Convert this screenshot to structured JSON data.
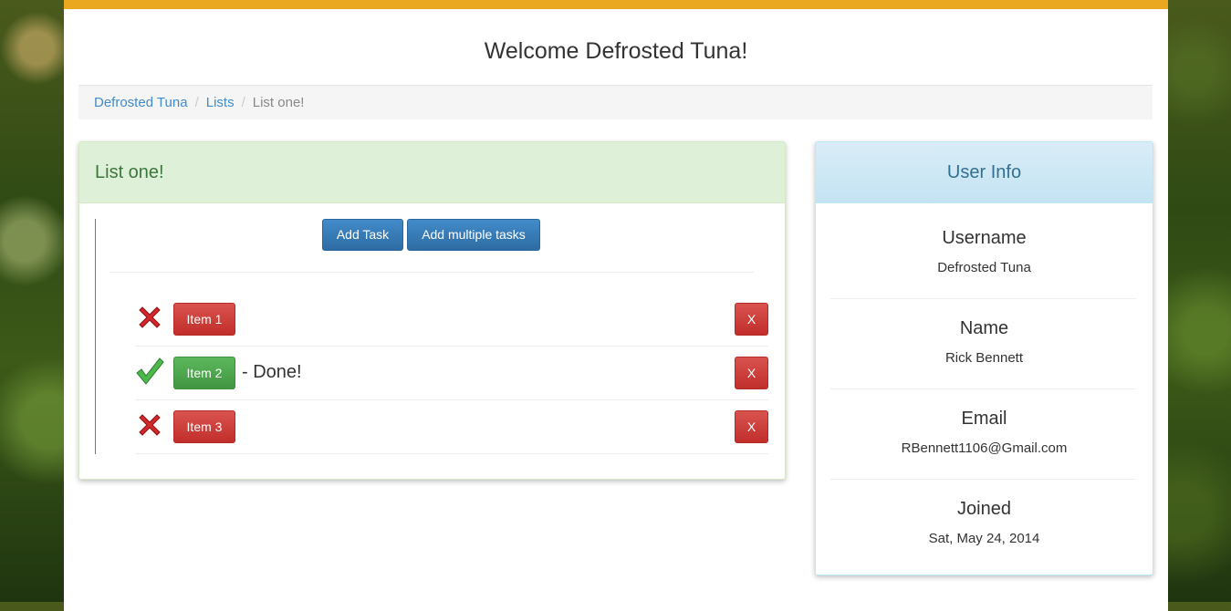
{
  "header": {
    "title": "Welcome Defrosted Tuna!"
  },
  "breadcrumb": {
    "items": [
      "Defrosted Tuna",
      "Lists"
    ],
    "active": "List one!",
    "separator": "/"
  },
  "list": {
    "title": "List one!",
    "add_task_label": "Add Task",
    "add_multiple_label": "Add multiple tasks",
    "delete_label": "X",
    "items": [
      {
        "label": "Item 1",
        "status_icon": "cross-icon",
        "done": false,
        "done_text": ""
      },
      {
        "label": "Item 2",
        "status_icon": "checkmark-icon",
        "done": true,
        "done_text": "- Done!"
      },
      {
        "label": "Item 3",
        "status_icon": "cross-icon",
        "done": false,
        "done_text": ""
      }
    ]
  },
  "user_info": {
    "title": "User Info",
    "fields": [
      {
        "label": "Username",
        "value": "Defrosted Tuna"
      },
      {
        "label": "Name",
        "value": "Rick Bennett"
      },
      {
        "label": "Email",
        "value": "RBennett1106@Gmail.com"
      },
      {
        "label": "Joined",
        "value": "Sat, May 24, 2014"
      }
    ]
  },
  "colors": {
    "accent": "#e9a81f",
    "primary": "#428bca",
    "danger": "#d9534f",
    "success": "#5cb85c",
    "list_header_bg": "#dff0d8",
    "user_header_bg": "#d9edf7"
  }
}
